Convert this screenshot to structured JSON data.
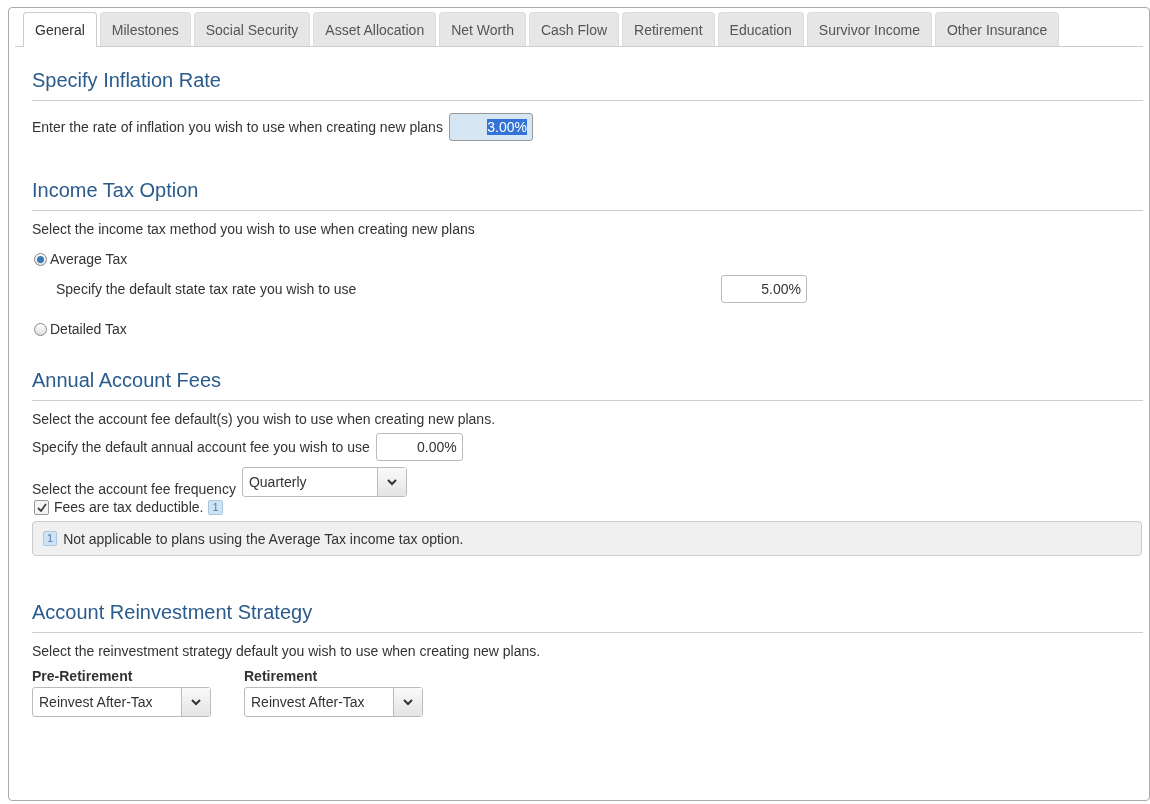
{
  "tabs": [
    {
      "label": "General",
      "selected": true
    },
    {
      "label": "Milestones",
      "selected": false
    },
    {
      "label": "Social Security",
      "selected": false
    },
    {
      "label": "Asset Allocation",
      "selected": false
    },
    {
      "label": "Net Worth",
      "selected": false
    },
    {
      "label": "Cash Flow",
      "selected": false
    },
    {
      "label": "Retirement",
      "selected": false
    },
    {
      "label": "Education",
      "selected": false
    },
    {
      "label": "Survivor Income",
      "selected": false
    },
    {
      "label": "Other Insurance",
      "selected": false
    }
  ],
  "inflation": {
    "heading": "Specify Inflation Rate",
    "label": "Enter the rate of inflation you wish to use when creating new plans",
    "value": "3.00%",
    "value_selected": true
  },
  "income_tax": {
    "heading": "Income Tax Option",
    "instruction": "Select the income tax method you wish to use when creating new plans",
    "options": [
      {
        "label": "Average Tax",
        "selected": true,
        "sub_label": "Specify the default state tax rate you wish to use",
        "sub_value": "5.00%"
      },
      {
        "label": "Detailed Tax",
        "selected": false
      }
    ]
  },
  "fees": {
    "heading": "Annual Account Fees",
    "instruction": "Select the account fee default(s) you wish to use when creating new plans.",
    "fee_label": "Specify the default annual account fee you wish to use",
    "fee_value": "0.00%",
    "frequency_label": "Select the account fee frequency",
    "frequency_value": "Quarterly",
    "checkbox": {
      "label": "Fees are tax deductible.",
      "checked": true,
      "footnote": "1"
    },
    "note": {
      "marker": "1",
      "text": "Not applicable to plans using the Average Tax income tax option."
    }
  },
  "reinvestment": {
    "heading": "Account Reinvestment Strategy",
    "instruction": "Select the reinvestment strategy default you wish to use when creating new plans.",
    "selects": [
      {
        "label": "Pre-Retirement",
        "value": "Reinvest After-Tax"
      },
      {
        "label": "Retirement",
        "value": "Reinvest After-Tax"
      }
    ]
  }
}
